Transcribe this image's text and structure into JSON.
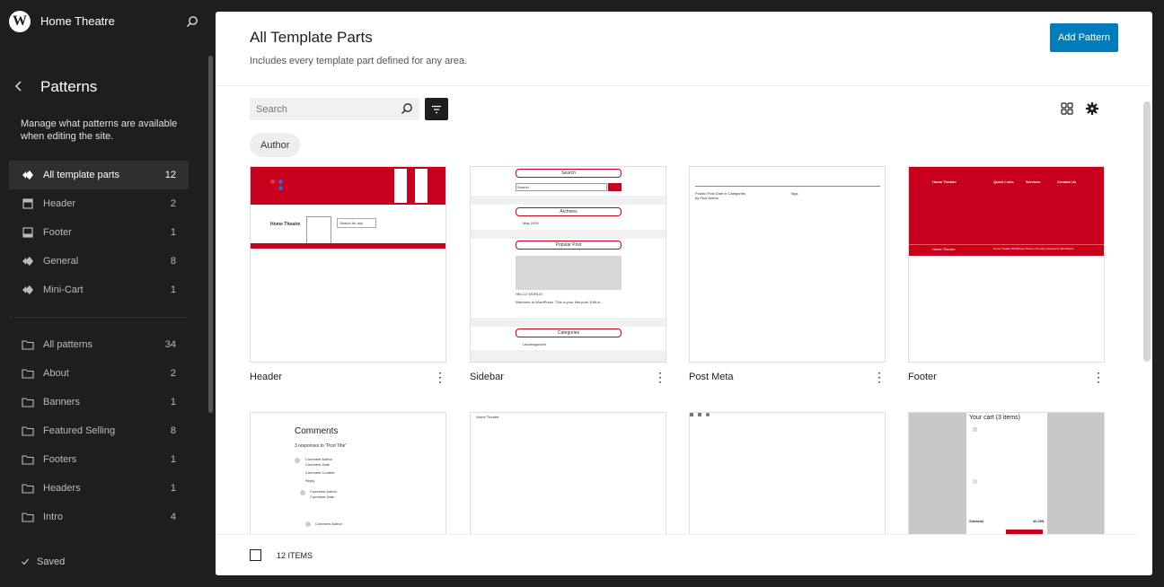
{
  "site": {
    "title": "Home Theatre"
  },
  "pane": {
    "back_label": "‹",
    "title": "Patterns",
    "description": "Manage what patterns are available when editing the site."
  },
  "nav_parts": [
    {
      "label": "All template parts",
      "count": "12",
      "icon": "symbol-icon"
    },
    {
      "label": "Header",
      "count": "2",
      "icon": "header-icon"
    },
    {
      "label": "Footer",
      "count": "1",
      "icon": "footer-icon"
    },
    {
      "label": "General",
      "count": "8",
      "icon": "symbol-icon"
    },
    {
      "label": "Mini-Cart",
      "count": "1",
      "icon": "symbol-icon"
    }
  ],
  "nav_patterns": [
    {
      "label": "All patterns",
      "count": "34"
    },
    {
      "label": "About",
      "count": "2"
    },
    {
      "label": "Banners",
      "count": "1"
    },
    {
      "label": "Featured Selling",
      "count": "8"
    },
    {
      "label": "Footers",
      "count": "1"
    },
    {
      "label": "Headers",
      "count": "1"
    },
    {
      "label": "Intro",
      "count": "4"
    }
  ],
  "status": {
    "saved": "Saved"
  },
  "main": {
    "title": "All Template Parts",
    "description": "Includes every template part defined for any area.",
    "add_button": "Add Pattern",
    "search_placeholder": "Search",
    "filter_chip": "Author",
    "items_count": "12 ITEMS"
  },
  "cards": [
    {
      "title": "Header"
    },
    {
      "title": "Sidebar"
    },
    {
      "title": "Post Meta"
    },
    {
      "title": "Footer"
    },
    {
      "title": "Comments"
    },
    {
      "title": ""
    },
    {
      "title": ""
    },
    {
      "title": ""
    }
  ],
  "thumbs": {
    "header": {
      "site_name": "Home Theatre",
      "search": "Search for any"
    },
    "sidebar": {
      "search": "Search",
      "search_input": "Search",
      "archives": "Archives",
      "archive_item": "May 2025",
      "popular": "Popular Post",
      "post_title": "HELLO WORLD!",
      "post_excerpt": "Welcome to WordPress. This is your first post. Edit or...",
      "categories": "Categories",
      "cat_item": "Uncategorized"
    },
    "postmeta": {
      "line1": "Posted Post Date in Categories",
      "line2": "by Post Author",
      "tags": "Tags"
    },
    "footer": {
      "brand": "Home Theatre",
      "col1": "Quick Links",
      "col2": "Services",
      "col3": "Contact Us",
      "bottom_left": "Home Theatre",
      "bottom_right": "Home Theatre WordPress Theme | Proudly powered by WordPress"
    },
    "comments": {
      "title": "Comments",
      "subtitle": "3 responses to “Post Title”",
      "author": "Comment Author",
      "date": "Comment Date",
      "content": "Comment Content",
      "reply": "Reply"
    },
    "card6": {
      "text": "Home Theatre"
    },
    "cart": {
      "title": "Your cart (3 items)",
      "subtotal": "Subtotal",
      "total": "40.00$"
    }
  },
  "colors": {
    "accent": "#007cba",
    "brand_red": "#c8001e",
    "sidebar_bg": "#1e1e1e"
  }
}
